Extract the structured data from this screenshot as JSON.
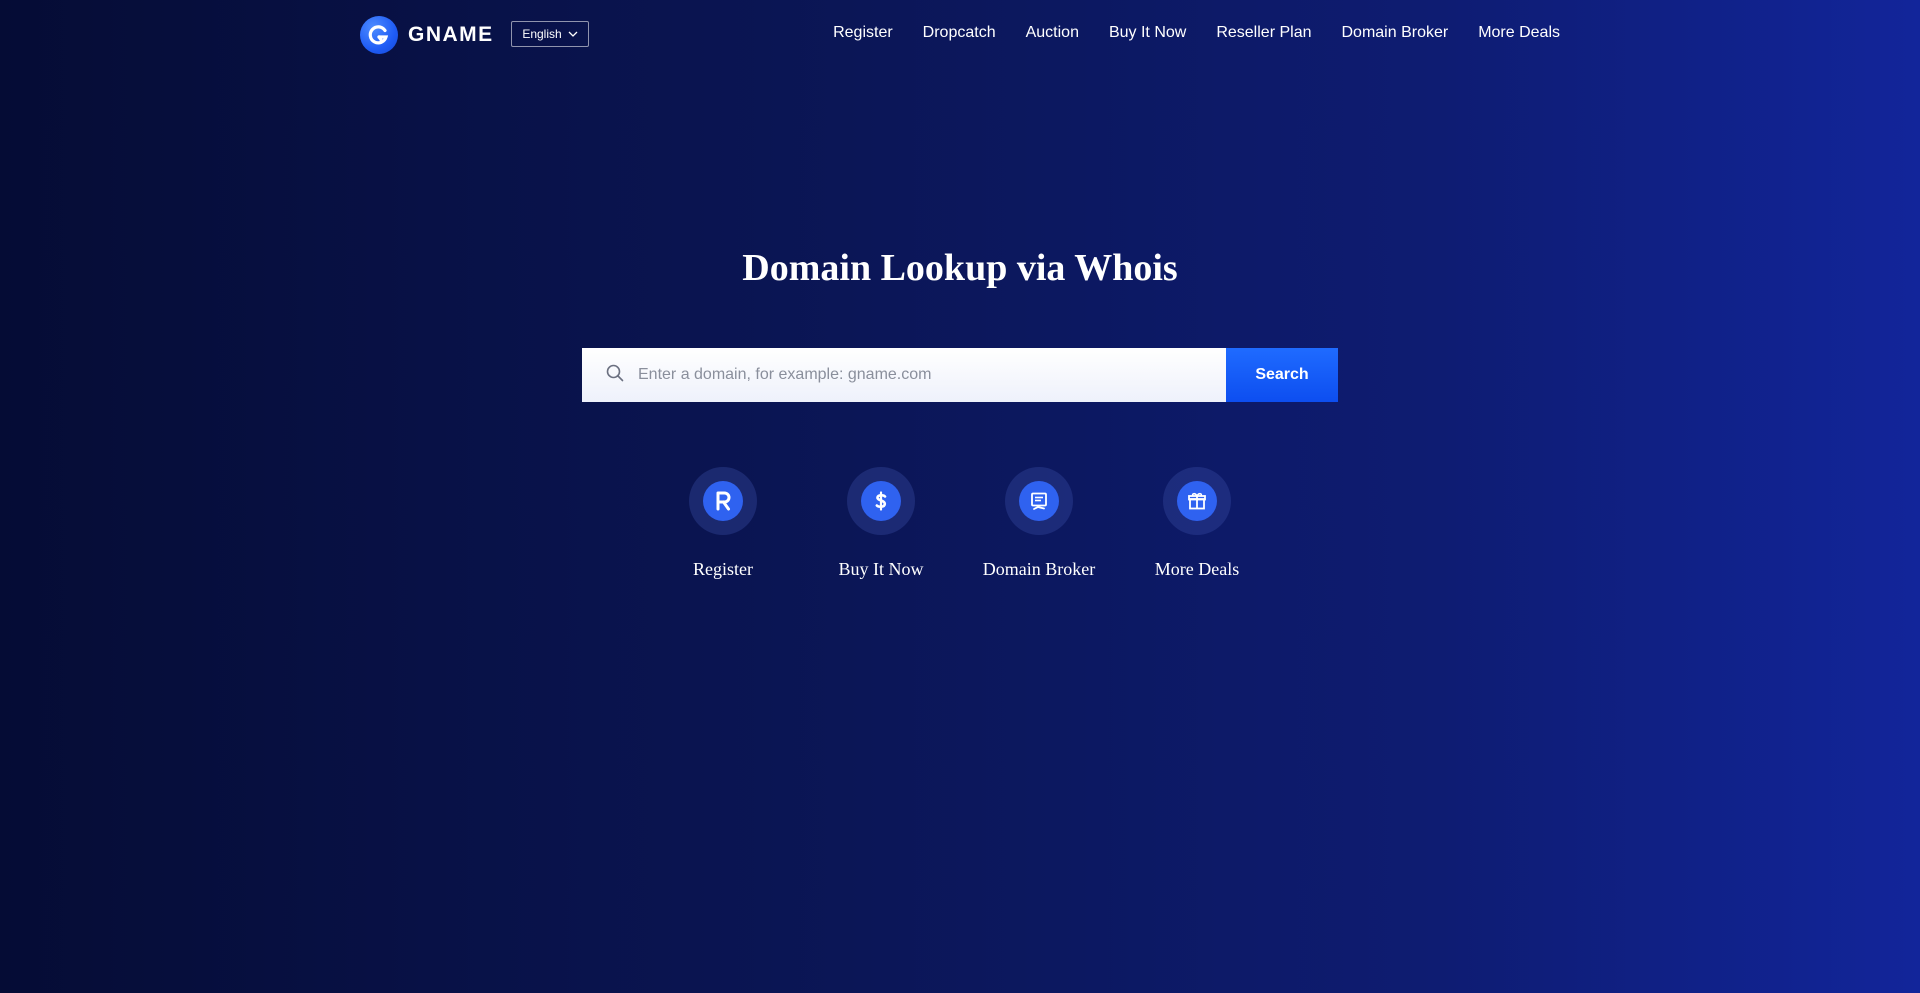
{
  "header": {
    "brand": "GNAME",
    "language": "English",
    "nav": [
      "Register",
      "Dropcatch",
      "Auction",
      "Buy It Now",
      "Reseller Plan",
      "Domain Broker",
      "More Deals"
    ]
  },
  "main": {
    "title": "Domain Lookup via Whois",
    "search": {
      "placeholder": "Enter a domain, for example: gname.com",
      "button_label": "Search"
    },
    "quick_links": [
      {
        "label": "Register",
        "icon": "registered-icon"
      },
      {
        "label": "Buy It Now",
        "icon": "dollar-icon"
      },
      {
        "label": "Domain Broker",
        "icon": "certificate-icon"
      },
      {
        "label": "More Deals",
        "icon": "gift-icon"
      }
    ]
  },
  "colors": {
    "accent": "#1f5cf5",
    "background": "#0b1657"
  }
}
